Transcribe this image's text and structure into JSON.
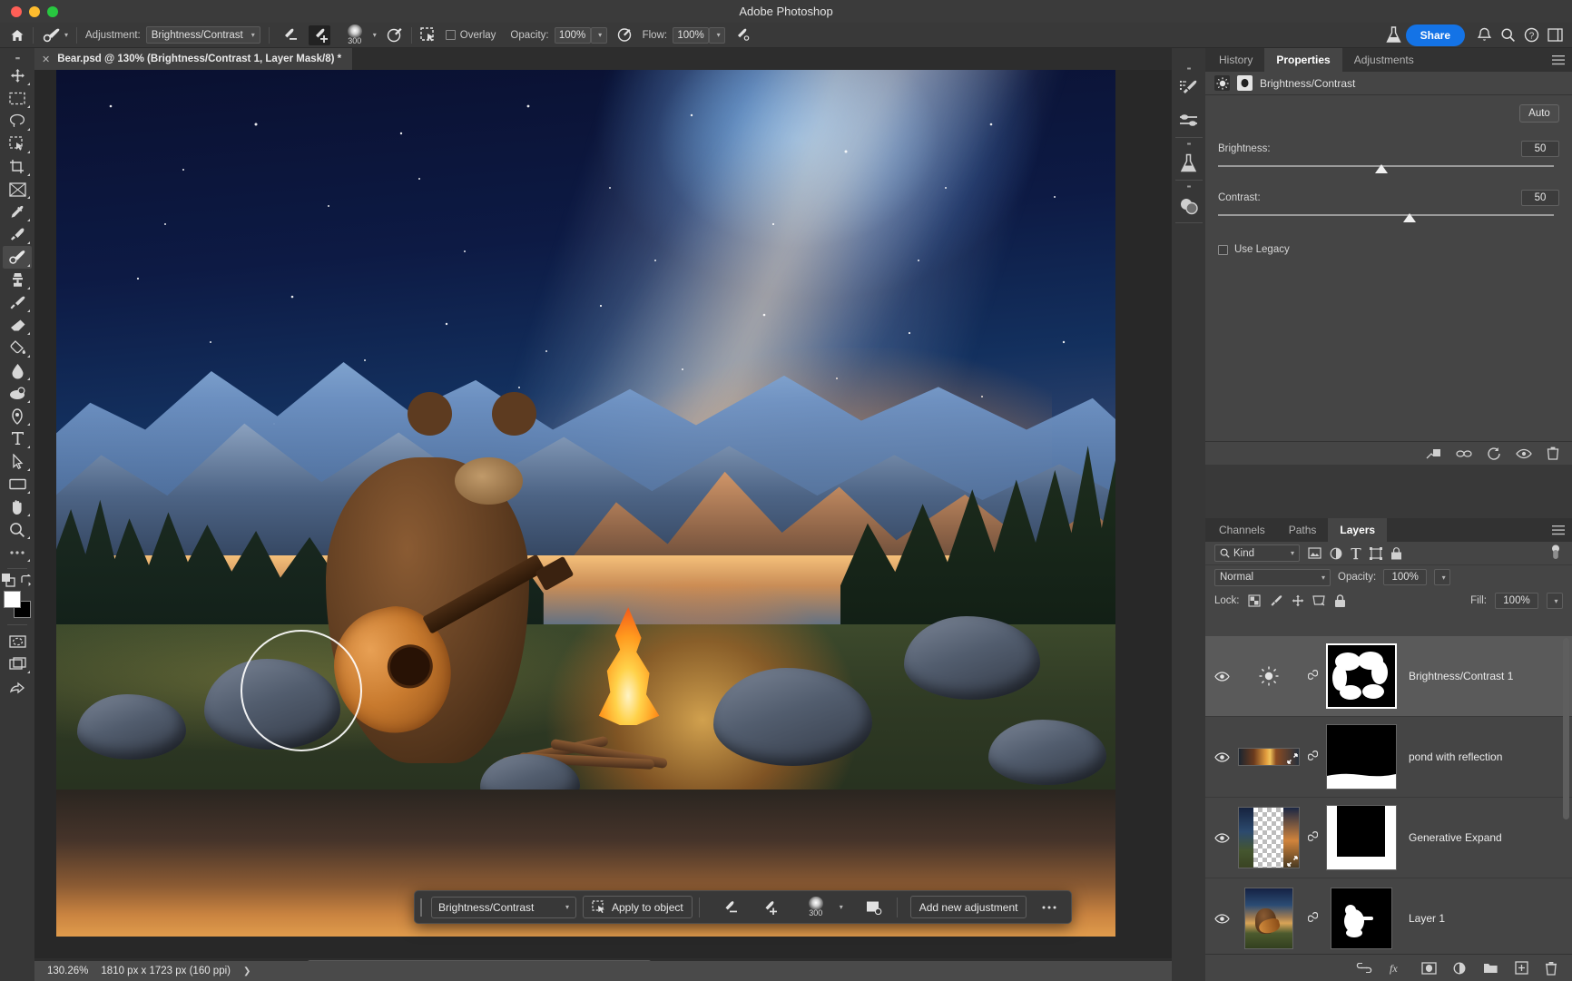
{
  "window": {
    "title": "Adobe Photoshop"
  },
  "options_bar": {
    "home_icon": "home-icon",
    "tool_preset_icon": "brush-tool-icon",
    "adjustment_label": "Adjustment:",
    "adjustment_value": "Brightness/Contrast",
    "subtract_brush_icon": "brush-minus-icon",
    "add_brush_icon": "brush-plus-icon",
    "brush_size": "300",
    "target_icon": "target-adjust-icon",
    "select_subject_icon": "select-subject-icon",
    "overlay_label": "Overlay",
    "opacity_label": "Opacity:",
    "opacity_value": "100%",
    "pressure_opacity_icon": "pressure-opacity-icon",
    "flow_label": "Flow:",
    "flow_value": "100%",
    "airbrush_icon": "airbrush-icon",
    "flask_icon": "flask-icon",
    "share_label": "Share",
    "bell_icon": "bell-icon",
    "search_icon": "search-icon",
    "help_icon": "help-icon",
    "workspace_icon": "workspace-icon"
  },
  "document_tab": {
    "close_icon": "close-icon",
    "title": "Bear.psd @ 130% (Brightness/Contrast 1, Layer Mask/8) *"
  },
  "toolbar": {
    "tools": [
      {
        "name": "move-tool",
        "icon": "move-icon",
        "selected": false
      },
      {
        "name": "marquee-tool",
        "icon": "rect-marquee-icon",
        "selected": false
      },
      {
        "name": "lasso-tool",
        "icon": "lasso-icon",
        "selected": false
      },
      {
        "name": "object-selection-tool",
        "icon": "object-select-icon",
        "selected": false
      },
      {
        "name": "crop-tool",
        "icon": "crop-icon",
        "selected": false
      },
      {
        "name": "frame-tool",
        "icon": "frame-icon",
        "selected": false
      },
      {
        "name": "eyedropper-tool",
        "icon": "eyedropper-icon",
        "selected": false
      },
      {
        "name": "spot-healing-tool",
        "icon": "healing-brush-icon",
        "selected": false
      },
      {
        "name": "brush-tool",
        "icon": "brush-icon",
        "selected": true
      },
      {
        "name": "clone-stamp-tool",
        "icon": "clone-stamp-icon",
        "selected": false
      },
      {
        "name": "history-brush-tool",
        "icon": "history-brush-icon",
        "selected": false
      },
      {
        "name": "eraser-tool",
        "icon": "eraser-icon",
        "selected": false
      },
      {
        "name": "gradient-tool",
        "icon": "paint-bucket-icon",
        "selected": false
      },
      {
        "name": "blur-tool",
        "icon": "blur-drop-icon",
        "selected": false
      },
      {
        "name": "dodge-tool",
        "icon": "dodge-icon",
        "selected": false
      },
      {
        "name": "pen-tool",
        "icon": "pen-icon",
        "selected": false
      },
      {
        "name": "type-tool",
        "icon": "type-icon",
        "selected": false
      },
      {
        "name": "path-selection-tool",
        "icon": "path-arrow-icon",
        "selected": false
      },
      {
        "name": "shape-tool",
        "icon": "rectangle-icon",
        "selected": false
      },
      {
        "name": "hand-tool",
        "icon": "hand-icon",
        "selected": false
      },
      {
        "name": "zoom-tool",
        "icon": "magnifier-icon",
        "selected": false
      },
      {
        "name": "edit-toolbar",
        "icon": "ellipsis-icon",
        "selected": false
      }
    ],
    "quick_mask_icon": "quick-mask-icon",
    "swap_colors_icon": "swap-colors-icon",
    "foreground_color": "#ffffff",
    "background_color": "#000000",
    "screen_mode_icon": "screen-mode-icon",
    "extra_icon": "share-canvas-icon"
  },
  "contextual_taskbar": {
    "adjustment_select": "Brightness/Contrast",
    "apply_label": "Apply to object",
    "apply_icon": "apply-to-object-icon",
    "subtract_icon": "brush-minus-icon",
    "add_icon": "brush-plus-icon",
    "brush_size": "300",
    "mask_icon": "mask-options-icon",
    "add_adjustment_label": "Add new adjustment",
    "more_icon": "more-options-icon"
  },
  "status_bar": {
    "zoom": "130.26%",
    "dimensions": "1810 px x 1723 px (160 ppi)",
    "expand_icon": "chevron-right-icon"
  },
  "right_rail": {
    "items": [
      {
        "name": "brush-settings-rail",
        "icon": "brush-settings-icon"
      },
      {
        "name": "adjustments-rail",
        "icon": "sliders-icon"
      },
      {
        "name": "libraries-rail",
        "icon": "flask-icon"
      },
      {
        "name": "color-rail",
        "icon": "color-swatch-icon"
      }
    ],
    "collapse_icon": "collapse-panels-icon"
  },
  "properties_panel": {
    "tabs": [
      {
        "label": "History",
        "active": false
      },
      {
        "label": "Properties",
        "active": true
      },
      {
        "label": "Adjustments",
        "active": false
      }
    ],
    "menu_icon": "panel-menu-icon",
    "header_title": "Brightness/Contrast",
    "header_adj_icon": "brightness-contrast-icon",
    "header_mask_icon": "layer-mask-icon",
    "auto_label": "Auto",
    "sliders": [
      {
        "label": "Brightness:",
        "value": "50",
        "pct": 48
      },
      {
        "label": "Contrast:",
        "value": "50",
        "pct": 56
      }
    ],
    "use_legacy_label": "Use Legacy",
    "use_legacy_checked": false,
    "footer_icons": [
      "clip-to-layer-icon",
      "view-previous-icon",
      "reset-icon",
      "toggle-visibility-icon",
      "delete-icon"
    ]
  },
  "layers_panel": {
    "tabs": [
      {
        "label": "Channels",
        "active": false
      },
      {
        "label": "Paths",
        "active": false
      },
      {
        "label": "Layers",
        "active": true
      }
    ],
    "menu_icon": "panel-menu-icon",
    "filter": {
      "search_icon": "search-icon",
      "kind_label": "Kind",
      "icons": [
        "filter-image-icon",
        "filter-adjustment-icon",
        "filter-type-icon",
        "filter-shape-icon",
        "filter-smart-object-icon",
        "filter-toggle-icon"
      ]
    },
    "blend_mode": "Normal",
    "opacity_label": "Opacity:",
    "opacity_value": "100%",
    "lock_label": "Lock:",
    "lock_icons": [
      "lock-transparent-icon",
      "lock-image-icon",
      "lock-position-icon",
      "lock-artboard-icon",
      "lock-all-icon"
    ],
    "fill_label": "Fill:",
    "fill_value": "100%",
    "layers": [
      {
        "name": "Brightness/Contrast 1",
        "visible": true,
        "selected": true,
        "kind": "adjustment",
        "mask_selected": true,
        "linked": true
      },
      {
        "name": "pond with reflection",
        "visible": true,
        "selected": false,
        "kind": "image",
        "mask_selected": false,
        "linked": true
      },
      {
        "name": "Generative Expand",
        "visible": true,
        "selected": false,
        "kind": "image",
        "mask_selected": false,
        "linked": true
      },
      {
        "name": "Layer 1",
        "visible": true,
        "selected": false,
        "kind": "image",
        "mask_selected": false,
        "linked": true
      }
    ],
    "footer_icons": [
      "link-layers-icon",
      "layer-style-fx-icon",
      "add-mask-icon",
      "new-adjustment-icon",
      "new-group-icon",
      "new-layer-icon",
      "delete-layer-icon"
    ]
  }
}
